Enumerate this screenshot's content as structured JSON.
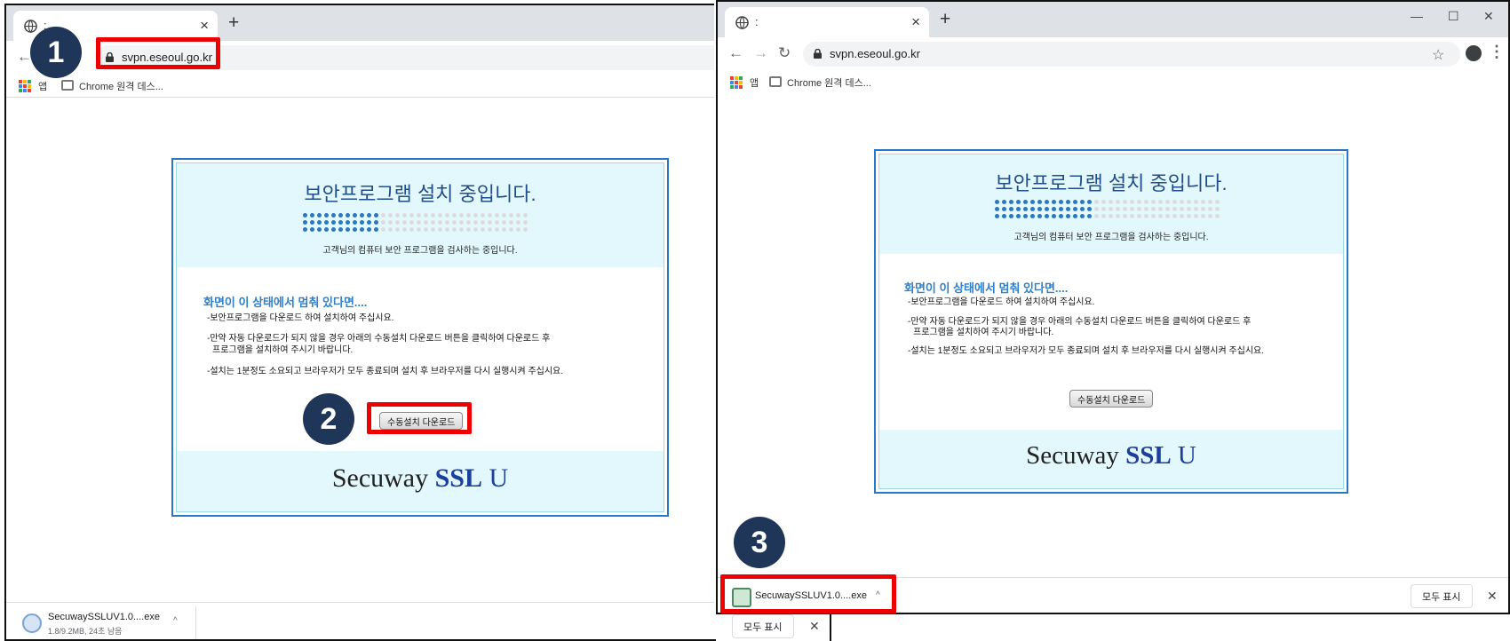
{
  "left_window": {
    "tab_title": ":",
    "url": "svpn.eseoul.go.kr",
    "bookmarks": {
      "apps": "앱",
      "remote_desktop": "Chrome 원격 데스..."
    },
    "download": {
      "filename": "SecuwaySSLUV1.0....exe",
      "status": "1.8/9.2MB, 24초 남음"
    }
  },
  "right_window": {
    "tab_title": ":",
    "url": "svpn.eseoul.go.kr",
    "bookmarks": {
      "apps": "앱",
      "remote_desktop": "Chrome 원격 데스..."
    },
    "download": {
      "filename": "SecuwaySSLUV1.0....exe"
    },
    "show_all": "모두 표시"
  },
  "left_bottom_show_all": "모두 표시",
  "vpn_page": {
    "title": "보안프로그램 설치 중입니다.",
    "subtitle": "고객님의 컴퓨터 보안 프로그램을 검사하는 중입니다.",
    "heading": "화면이 이 상태에서 멈춰 있다면....",
    "line1": "-보안프로그램을 다운로드 하여 설치하여 주십시요.",
    "line2a": "-만약 자동 다운로드가 되지 않을 경우 아래의 수동설치 다운로드 버튼을 클릭하여 다운로드 후",
    "line2b": "프로그램을 설치하여 주시기 바랍니다.",
    "line3": "-설치는 1분정도 소요되고 브라우저가 모두 종료되며 설치 후 브라우저를 다시 실행시켜 주십시요.",
    "button": "수동설치 다운로드",
    "brand_secuway": "Secuway",
    "brand_ssl": "SSL",
    "brand_u": "U"
  },
  "steps": [
    "1",
    "2",
    "3"
  ],
  "icons": {
    "tab": "globe-icon",
    "close": "close-icon",
    "new_tab": "plus-icon",
    "back": "back-arrow-icon",
    "forward": "forward-arrow-icon",
    "reload": "reload-icon",
    "lock": "lock-icon",
    "star": "star-icon",
    "profile": "profile-icon",
    "menu": "kebab-menu-icon",
    "apps": "apps-grid-icon",
    "remote_desktop": "remote-desktop-icon",
    "download_file": "installer-file-icon",
    "caret": "chevron-up-icon",
    "minimize": "minimize-icon",
    "maximize": "maximize-icon"
  },
  "colors": {
    "highlight": "#ee0000",
    "step_badge": "#1f3658",
    "panel_border": "#2878c8",
    "panel_fill": "#e3f8fc",
    "heading_blue": "#2f7fca"
  }
}
